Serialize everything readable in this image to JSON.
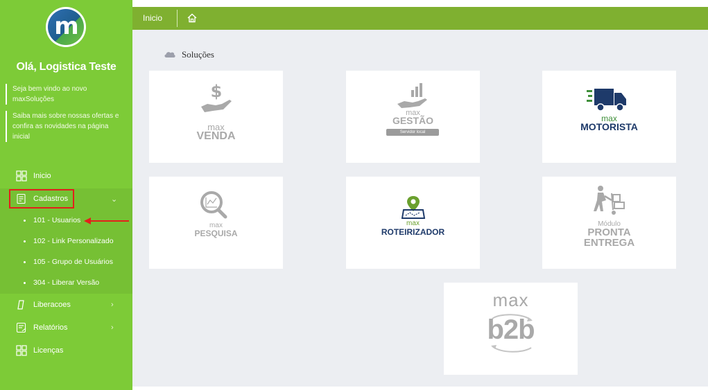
{
  "sidebar": {
    "logo_letter": "m",
    "greeting": "Olá, Logistica Teste",
    "notes": [
      "Seja bem vindo ao novo maxSoluções",
      "Saiba mais sobre nossas ofertas e confira as novidades na página inicial"
    ],
    "menu": {
      "inicio": "Inicio",
      "cadastros": "Cadastros",
      "sub": [
        "101 - Usuarios",
        "102 - Link Personalizado",
        "105 - Grupo de Usuários",
        "304 - Liberar Versão"
      ],
      "liberacoes": "Liberacoes",
      "relatorios": "Relatórios",
      "licencas": "Licenças"
    }
  },
  "topbar": {
    "title": "Inicio",
    "home_icon": "home-icon"
  },
  "main": {
    "section_title": "Soluções",
    "cards": {
      "venda": {
        "small": "max",
        "big": "VENDA"
      },
      "gestao": {
        "small": "max",
        "big": "GESTÃO",
        "badge": "Servidor local"
      },
      "motorista": {
        "small": "max",
        "big": "MOTORISTA"
      },
      "pesquisa": {
        "small": "max",
        "big": "PESQUISA"
      },
      "roteirizador": {
        "small": "max",
        "big": "ROTEIRIZADOR"
      },
      "pronta": {
        "small": "Módulo",
        "big1": "PRONTA",
        "big2": "ENTREGA"
      },
      "b2b": {
        "small": "max",
        "big": "b2b"
      }
    }
  },
  "colors": {
    "sidebar": "#7dcb37",
    "topbar": "#7fb030",
    "highlight": "#e3201b",
    "navy": "#1e3a6a"
  }
}
